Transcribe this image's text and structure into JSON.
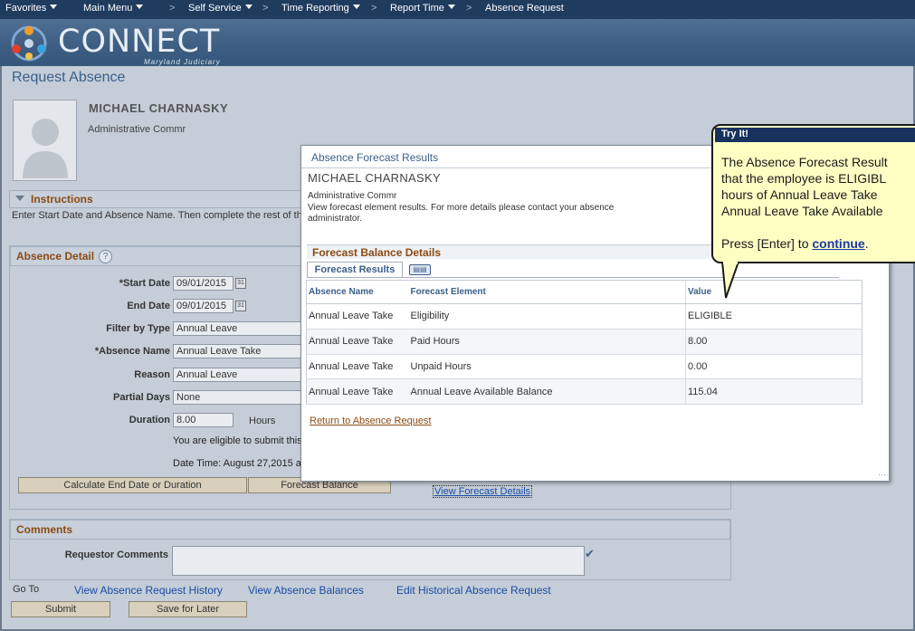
{
  "nav": {
    "favorites": "Favorites",
    "main_menu": "Main Menu",
    "self_service": "Self Service",
    "time_reporting": "Time Reporting",
    "report_time": "Report Time",
    "absence_request": "Absence Request",
    "sep": ">"
  },
  "brand": {
    "name": "CONNECT",
    "sub": "Maryland Judiciary"
  },
  "page": {
    "title": "Request Absence"
  },
  "employee": {
    "name": "MICHAEL CHARNASKY",
    "title": "Administrative Commr"
  },
  "instructions": {
    "title": "Instructions",
    "text": "Enter Start Date and Absence Name. Then complete the rest of the"
  },
  "absence_detail": {
    "title": "Absence Detail",
    "help": "?",
    "fields": {
      "start_date": {
        "label": "*Start Date",
        "value": "09/01/2015"
      },
      "end_date": {
        "label": "End Date",
        "value": "09/01/2015"
      },
      "filter_by_type": {
        "label": "Filter by Type",
        "value": "Annual Leave"
      },
      "absence_name": {
        "label": "*Absence Name",
        "value": "Annual Leave Take"
      },
      "reason": {
        "label": "Reason",
        "value": "Annual Leave"
      },
      "partial_days": {
        "label": "Partial Days",
        "value": "None"
      },
      "duration": {
        "label": "Duration",
        "value": "8.00",
        "unit": "Hours"
      }
    },
    "eligibility_text": "You are eligible to submit this",
    "datetime_text": "Date Time: August 27,2015 a",
    "calc_button": "Calculate End Date or Duration",
    "forecast_button": "Forecast Balance",
    "view_forecast_link": "View Forecast Details"
  },
  "comments": {
    "title": "Comments",
    "requestor_label": "Requestor Comments"
  },
  "goto": {
    "label": "Go To",
    "links": [
      "View Absence Request History",
      "View Absence Balances",
      "Edit Historical Absence Request"
    ]
  },
  "actions": {
    "submit": "Submit",
    "save_for_later": "Save for Later"
  },
  "modal": {
    "title": "Absence Forecast Results",
    "employee_name": "MICHAEL CHARNASKY",
    "employee_title": "Administrative Commr",
    "description": "View forecast element results. For more details please contact your absence administrator.",
    "section_title": "Forecast Balance Details",
    "tab_label": "Forecast Results",
    "columns": [
      "Absence Name",
      "Forecast Element",
      "Value"
    ],
    "rows": [
      [
        "Annual Leave Take",
        "Eligibility",
        "ELIGIBLE"
      ],
      [
        "Annual Leave Take",
        "Paid Hours",
        "8.00"
      ],
      [
        "Annual Leave Take",
        "Unpaid Hours",
        "0.00"
      ],
      [
        "Annual Leave Take",
        "Annual Leave Available Balance",
        "115.04"
      ]
    ],
    "return_link": "Return to Absence Request"
  },
  "callout": {
    "header": "Try It!",
    "line1": "The Absence Forecast Result",
    "line2": "that the employee is ELIGIBL",
    "line3": "hours of Annual Leave Take",
    "line4": "Annual Leave Take Available",
    "press_prefix": "Press [Enter] to ",
    "press_link": "continue",
    "press_suffix": "."
  }
}
